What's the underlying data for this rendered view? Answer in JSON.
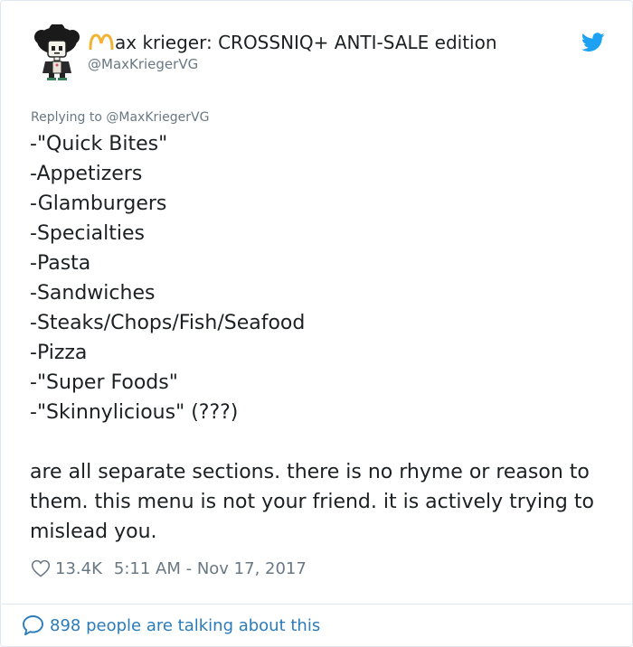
{
  "author": {
    "display_name_rest": "ax krieger: CROSSNIQ+ ANTI-SALE edition",
    "handle": "@MaxKriegerVG",
    "logo_letter": "M"
  },
  "tweet": {
    "replying_to": "Replying to @MaxKriegerVG",
    "lines": [
      "-\"Quick Bites\"",
      "-Appetizers",
      "-Glamburgers",
      "-Specialties",
      "-Pasta",
      "-Sandwiches",
      "-Steaks/Chops/Fish/Seafood",
      "-Pizza",
      "-\"Super Foods\"",
      "-\"Skinnylicious\" (???)"
    ],
    "closing": "are all separate sections. there is no rhyme or reason to them. this menu is not your friend. it is actively trying to mislead you.",
    "likes": "13.4K",
    "timestamp": "5:11 AM - Nov 17, 2017"
  },
  "footer": {
    "talking_label": "898 people are talking about this"
  },
  "colors": {
    "text": "#1c2022",
    "secondary": "#697882",
    "link": "#2b7bb9",
    "twitter_blue": "#1da1f2",
    "logo_gold": "#f2b233",
    "border": "#e1e8ed"
  },
  "icons": {
    "avatar": "avatar",
    "logo": "golden-m-icon",
    "brand": "twitter-bird-icon",
    "like": "heart-icon",
    "conversation": "speech-bubble-icon"
  }
}
